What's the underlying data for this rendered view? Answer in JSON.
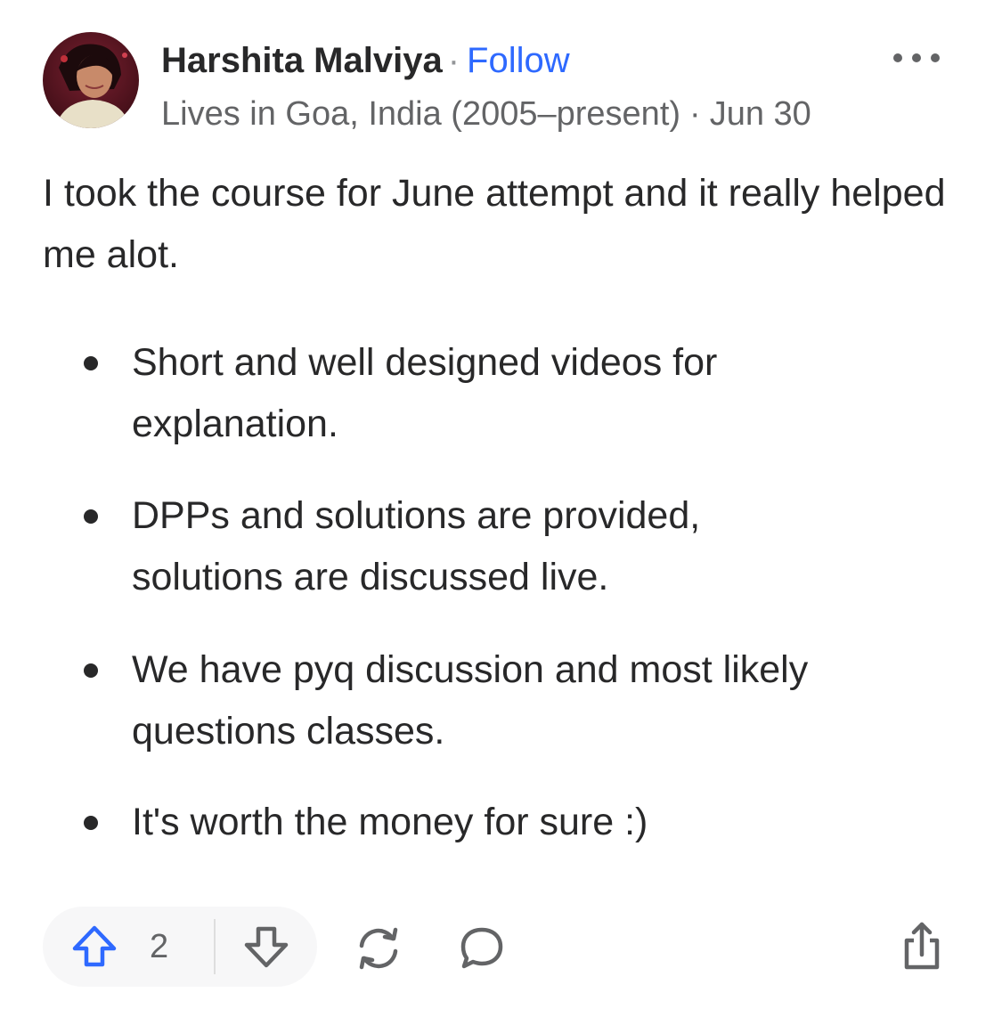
{
  "post": {
    "author": {
      "name": "Harshita Malviya",
      "separator": "·",
      "follow_label": "Follow",
      "credential": "Lives in Goa, India (2005–present)",
      "date": "Jun 30"
    },
    "body": {
      "intro": "I took the course for June attempt and it really helped me alot.",
      "bullets": [
        "Short and well designed videos for explanation.",
        "DPPs and solutions are provided, solutions are discussed live.",
        "We have pyq discussion and most likely questions classes.",
        "It's worth the money for sure :)"
      ]
    },
    "actions": {
      "upvote_count": "2"
    }
  },
  "icons": {
    "more": "more-horizontal-icon",
    "upvote": "upvote-arrow-icon",
    "downvote": "downvote-arrow-icon",
    "reshare": "reshare-icon",
    "comment": "comment-bubble-icon",
    "share": "share-export-icon"
  },
  "colors": {
    "text": "#282829",
    "secondary_text": "#636466",
    "link": "#2e69ff",
    "pill_background": "#f7f7f8"
  }
}
